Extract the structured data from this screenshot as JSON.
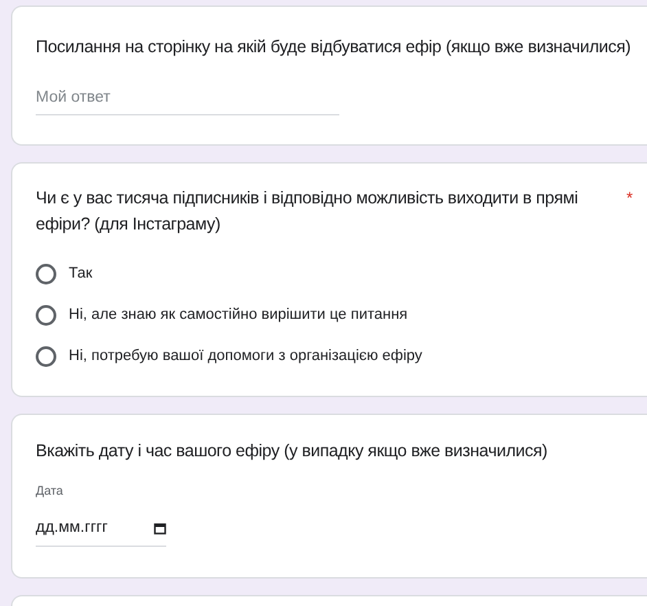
{
  "questions": [
    {
      "kind": "text",
      "title": "Посилання на сторінку на якій буде відбуватися ефір (якщо вже визначилися)",
      "placeholder": "Мой ответ"
    },
    {
      "kind": "radio",
      "title": "Чи є у вас тисяча підписників і відповідно можливість виходити в прямі ефіри? (для Інстаграму)",
      "required_mark": "*",
      "options": [
        {
          "label": "Так",
          "selected": false
        },
        {
          "label": "Ні, але знаю як самостійно вирішити це питання",
          "selected": false
        },
        {
          "label": "Ні, потребую вашої допомоги з організацією ефіру",
          "selected": false
        }
      ]
    },
    {
      "kind": "date",
      "title": "Вкажіть дату і час вашого ефіру (у випадку якщо вже визначилися)",
      "field_label": "Дата",
      "placeholder": "дд.мм.гггг"
    },
    {
      "kind": "blank"
    }
  ]
}
